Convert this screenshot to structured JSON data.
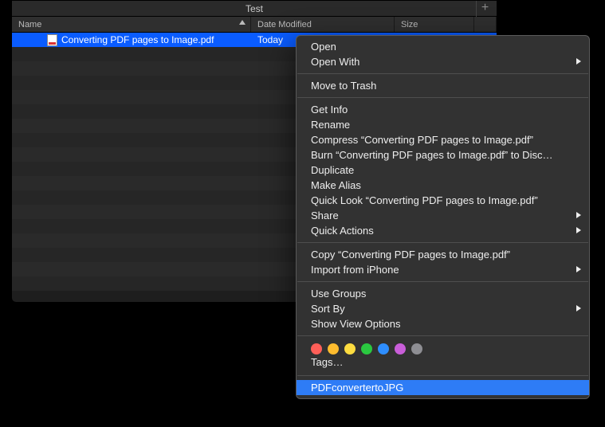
{
  "window": {
    "title": "Test"
  },
  "columns": {
    "name": "Name",
    "date": "Date Modified",
    "size": "Size"
  },
  "file": {
    "name": "Converting PDF pages to Image.pdf",
    "date": "Today"
  },
  "context_menu": {
    "groups": [
      [
        {
          "label": "Open",
          "submenu": false
        },
        {
          "label": "Open With",
          "submenu": true
        }
      ],
      [
        {
          "label": "Move to Trash",
          "submenu": false
        }
      ],
      [
        {
          "label": "Get Info",
          "submenu": false
        },
        {
          "label": "Rename",
          "submenu": false
        },
        {
          "label": "Compress “Converting PDF pages to Image.pdf”",
          "submenu": false
        },
        {
          "label": "Burn “Converting PDF pages to Image.pdf” to Disc…",
          "submenu": false
        },
        {
          "label": "Duplicate",
          "submenu": false
        },
        {
          "label": "Make Alias",
          "submenu": false
        },
        {
          "label": "Quick Look “Converting PDF pages to Image.pdf”",
          "submenu": false
        },
        {
          "label": "Share",
          "submenu": true
        },
        {
          "label": "Quick Actions",
          "submenu": true
        }
      ],
      [
        {
          "label": "Copy “Converting PDF pages to Image.pdf”",
          "submenu": false
        },
        {
          "label": "Import from iPhone",
          "submenu": true
        }
      ],
      [
        {
          "label": "Use Groups",
          "submenu": false
        },
        {
          "label": "Sort By",
          "submenu": true
        },
        {
          "label": "Show View Options",
          "submenu": false
        }
      ]
    ],
    "tags": {
      "colors": [
        "#fe5f58",
        "#febc2e",
        "#fddc40",
        "#2ac840",
        "#2e8eff",
        "#c95ed9",
        "#8e8e93"
      ],
      "label": "Tags…"
    },
    "service": {
      "label": "PDFconvertertoJPG",
      "highlighted": true
    }
  }
}
